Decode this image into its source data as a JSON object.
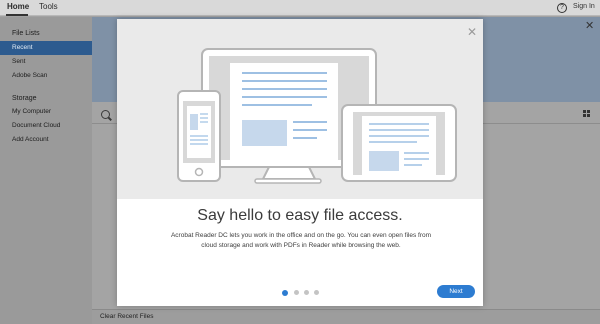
{
  "header": {
    "tabs": [
      {
        "label": "Home"
      },
      {
        "label": "Tools"
      }
    ],
    "help_icon": "question-circle-icon",
    "sign_in": "Sign In"
  },
  "sidebar": {
    "file_lists_heading": "File Lists",
    "file_items": [
      {
        "label": "Recent"
      },
      {
        "label": "Sent"
      },
      {
        "label": "Adobe Scan"
      }
    ],
    "storage_heading": "Storage",
    "storage_items": [
      {
        "label": "My Computer"
      },
      {
        "label": "Document Cloud"
      },
      {
        "label": "Add Account"
      }
    ]
  },
  "footer": {
    "clear_recent": "Clear Recent Files"
  },
  "modal": {
    "title": "Say hello to easy file access.",
    "body": "Acrobat Reader DC lets you work in the office and on the go. You can even open files from cloud storage and work with PDFs in Reader while browsing the web.",
    "next_label": "Next",
    "pagination": {
      "current": 1,
      "total": 4
    },
    "accent": "#2d7cd1"
  }
}
